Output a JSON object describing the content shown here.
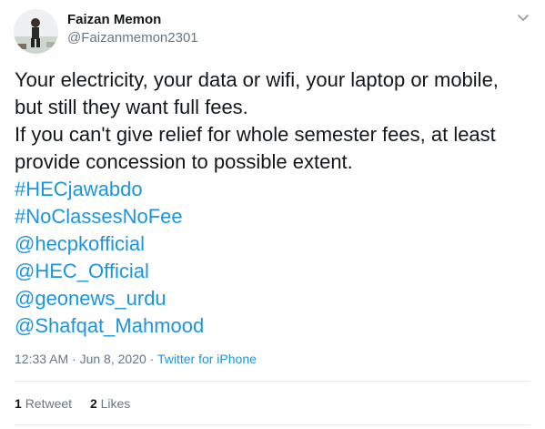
{
  "author": {
    "name": "Faizan Memon",
    "handle": "@Faizanmemon2301"
  },
  "tweet": {
    "lines": [
      "Your electricity, your data or wifi, your laptop or mobile,",
      "but still they want full fees.",
      "If you can't give relief for whole semester fees, at least",
      "provide concession to possible extent."
    ],
    "links": [
      "#HECjawabdo",
      "#NoClassesNoFee",
      "@hecpkofficial",
      "@HEC_Official",
      "@geonews_urdu",
      "@Shafqat_Mahmood"
    ]
  },
  "meta": {
    "time": "12:33 AM · Jun 8, 2020 · ",
    "source": "Twitter for iPhone"
  },
  "stats": {
    "retweets_count": "1",
    "retweets_label": "Retweet",
    "likes_count": "2",
    "likes_label": "Likes"
  },
  "colors": {
    "link": "#1b95e0",
    "muted": "#657786",
    "text": "#14171a"
  },
  "icons": {
    "more": "chevron-down-icon",
    "avatar": "profile-photo"
  }
}
